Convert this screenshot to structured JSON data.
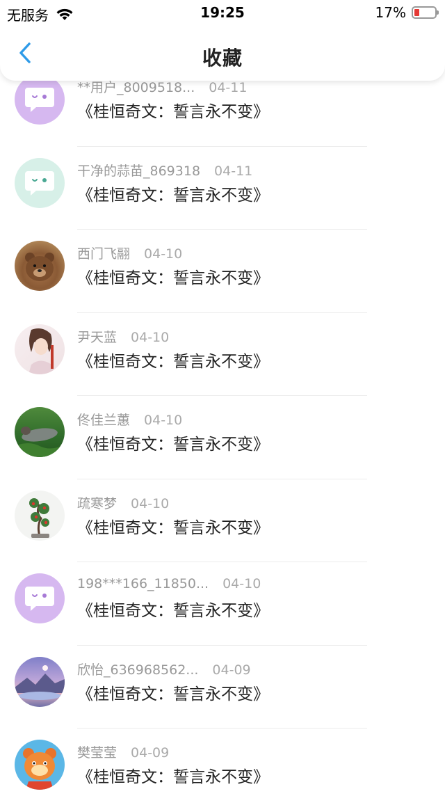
{
  "status_bar": {
    "carrier": "无服务",
    "time": "19:25",
    "battery": "17%",
    "battery_level": 0.17,
    "battery_color": "#e53935"
  },
  "navbar": {
    "title": "收藏",
    "back_icon": "chevron-left-icon",
    "accent": "#2f9be8"
  },
  "items": [
    {
      "user": "**用户_8009518...",
      "date": "04-11",
      "title": "《桂恒奇文：誓言永不变》",
      "avatar": "chat-bubble-purple"
    },
    {
      "user": "干净的蒜苗_869318",
      "date": "04-11",
      "title": "《桂恒奇文：誓言永不变》",
      "avatar": "chat-bubble-mint"
    },
    {
      "user": "西门飞翮",
      "date": "04-10",
      "title": "《桂恒奇文：誓言永不变》",
      "avatar": "bear-photo"
    },
    {
      "user": "尹天蓝",
      "date": "04-10",
      "title": "《桂恒奇文：誓言永不变》",
      "avatar": "anime-girl-photo"
    },
    {
      "user": "佟佳兰蕙",
      "date": "04-10",
      "title": "《桂恒奇文：誓言永不变》",
      "avatar": "grass-photo"
    },
    {
      "user": "疏寒梦",
      "date": "04-10",
      "title": "《桂恒奇文：誓言永不变》",
      "avatar": "bonsai-photo"
    },
    {
      "user": "198***166_11850...",
      "date": "04-10",
      "title": "《桂恒奇文：誓言永不变》",
      "avatar": "chat-bubble-purple"
    },
    {
      "user": "欣怡_636968562...",
      "date": "04-09",
      "title": "《桂恒奇文：誓言永不变》",
      "avatar": "sky-photo"
    },
    {
      "user": "樊莹莹",
      "date": "04-09",
      "title": "《桂恒奇文：誓言永不变》",
      "avatar": "cartoon-cat-photo"
    }
  ]
}
